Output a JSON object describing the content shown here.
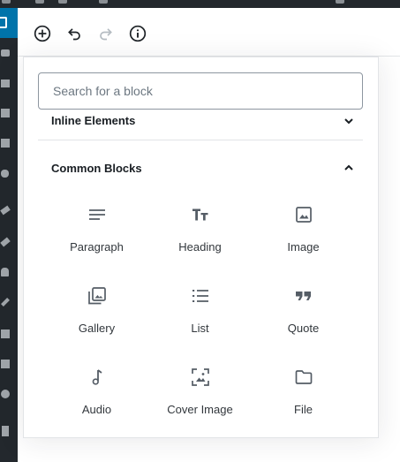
{
  "toolbar": {
    "add_block_icon": "plus-circle-icon",
    "undo_icon": "undo-icon",
    "redo_icon": "redo-icon",
    "info_icon": "info-icon"
  },
  "inserter": {
    "search": {
      "placeholder": "Search for a block",
      "value": ""
    },
    "panels": [
      {
        "title": "Inline Elements",
        "state": "collapsed",
        "icon": "chevron-down-icon"
      },
      {
        "title": "Common Blocks",
        "state": "expanded",
        "icon": "chevron-up-icon"
      }
    ],
    "blocks": [
      {
        "label": "Paragraph",
        "icon": "paragraph-icon"
      },
      {
        "label": "Heading",
        "icon": "heading-icon"
      },
      {
        "label": "Image",
        "icon": "image-icon"
      },
      {
        "label": "Gallery",
        "icon": "gallery-icon"
      },
      {
        "label": "List",
        "icon": "list-icon"
      },
      {
        "label": "Quote",
        "icon": "quote-icon"
      },
      {
        "label": "Audio",
        "icon": "audio-icon"
      },
      {
        "label": "Cover Image",
        "icon": "cover-image-icon"
      },
      {
        "label": "File",
        "icon": "file-icon"
      }
    ]
  },
  "colors": {
    "admin_dark": "#23282d",
    "admin_accent": "#0073aa",
    "icon": "#555d66",
    "text": "#32373c",
    "border": "#e2e4e7"
  }
}
